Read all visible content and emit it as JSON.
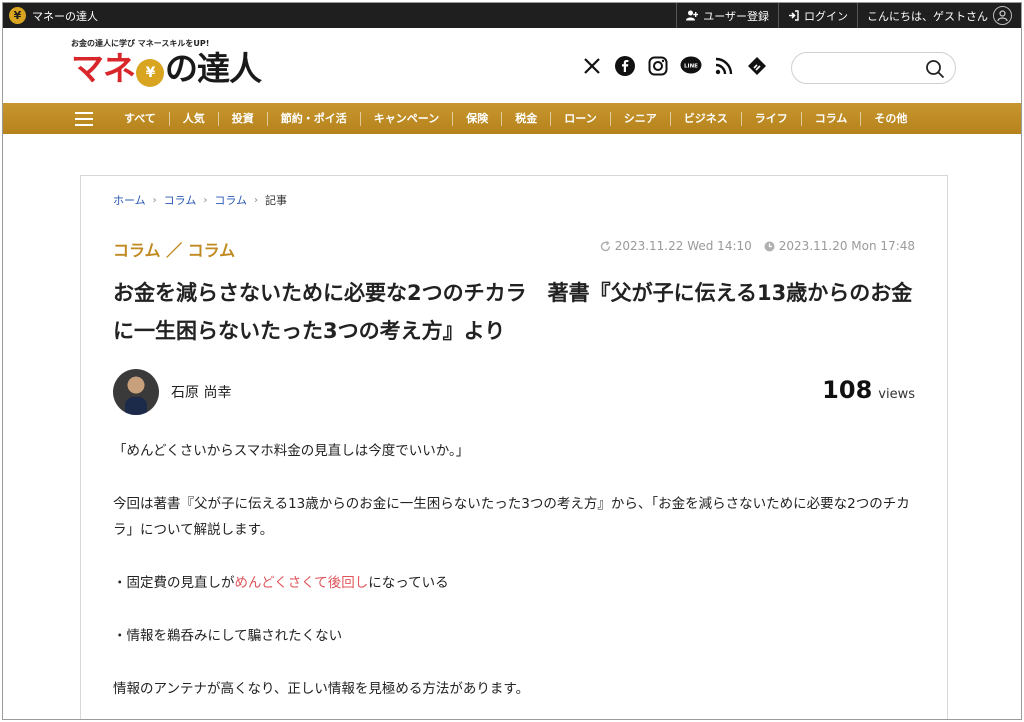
{
  "topbar": {
    "brand_icon": "¥",
    "site_name": "マネーの達人",
    "register_label": "ユーザー登録",
    "login_label": "ログイン",
    "greeting": "こんにちは、ゲストさん"
  },
  "header": {
    "logo_tagline": "お金の達人に学び マネースキルをUP!",
    "logo_part1": "マネ",
    "logo_coin": "¥",
    "logo_part2": "の達人",
    "search_placeholder": ""
  },
  "social_icons": [
    "x-icon",
    "facebook-icon",
    "instagram-icon",
    "line-icon",
    "rss-icon",
    "feedly-icon"
  ],
  "nav": {
    "items": [
      "すべて",
      "人気",
      "投資",
      "節約・ポイ活",
      "キャンペーン",
      "保険",
      "税金",
      "ローン",
      "シニア",
      "ビジネス",
      "ライフ",
      "コラム",
      "その他"
    ]
  },
  "article": {
    "breadcrumb": [
      "ホーム",
      "コラム",
      "コラム",
      "記事"
    ],
    "category": "コラム ／ コラム",
    "updated": "2023.11.22 Wed 14:10",
    "published": "2023.11.20 Mon 17:48",
    "title": "お金を減らさないために必要な2つのチカラ　著書『父が子に伝える13歳からのお金に一生困らないたった3つの考え方』より",
    "author": "石原 尚幸",
    "views_count": "108",
    "views_label": "views",
    "paragraphs": {
      "p1": "「めんどくさいからスマホ料金の見直しは今度でいいか。」",
      "p2": "今回は著書『父が子に伝える13歳からのお金に一生困らないたった3つの考え方』から、「お金を減らさないために必要な2つのチカラ」について解説します。",
      "b1_pre": "・固定費の見直しが",
      "b1_highlight": "めんどくさくて後回し",
      "b1_post": "になっている",
      "b2": "・情報を鵜呑みにして騙されたくない",
      "p3": "情報のアンテナが高くなり、正しい情報を見極める方法があります。"
    }
  },
  "colors": {
    "accent_gold": "#c08a20",
    "nav_gold": "#b5821c",
    "link_blue": "#2a59b5",
    "highlight_red": "#e0555a",
    "topbar_dark": "#1f1f1f"
  }
}
